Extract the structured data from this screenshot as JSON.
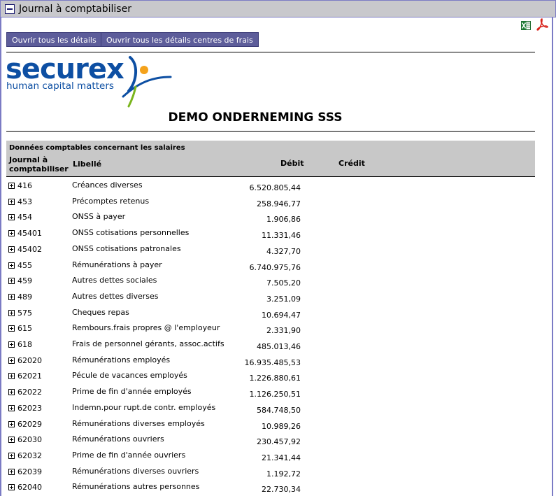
{
  "window": {
    "title": "Journal à comptabiliser"
  },
  "toolbar": {
    "open_all_label": "Ouvrir tous les détails",
    "open_all_cost_centers_label": "Ouvrir tous les détails centres de frais"
  },
  "logo": {
    "brand": "securex",
    "tagline": "human capital matters"
  },
  "company": {
    "name": "DEMO ONDERNEMING SSS"
  },
  "table": {
    "section_title": "Données comptables concernant les salaires",
    "headers": {
      "journal": "Journal à comptabiliser",
      "libelle": "Libellé",
      "debit": "Débit",
      "credit": "Crédit"
    },
    "rows": [
      {
        "account": "416",
        "label": "Créances diverses",
        "debit": "6.520.805,44"
      },
      {
        "account": "453",
        "label": "Précomptes retenus",
        "debit": "258.946,77"
      },
      {
        "account": "454",
        "label": "ONSS à payer",
        "debit": "1.906,86"
      },
      {
        "account": "45401",
        "label": "ONSS cotisations personnelles",
        "debit": "11.331,46"
      },
      {
        "account": "45402",
        "label": "ONSS cotisations patronales",
        "debit": "4.327,70"
      },
      {
        "account": "455",
        "label": "Rémunérations à payer",
        "debit": "6.740.975,76"
      },
      {
        "account": "459",
        "label": "Autres dettes sociales",
        "debit": "7.505,20"
      },
      {
        "account": "489",
        "label": "Autres dettes diverses",
        "debit": "3.251,09"
      },
      {
        "account": "575",
        "label": "Cheques repas",
        "debit": "10.694,47"
      },
      {
        "account": "615",
        "label": "Rembours.frais propres @ l'employeur",
        "debit": "2.331,90"
      },
      {
        "account": "618",
        "label": "Frais de personnel gérants, assoc.actifs",
        "debit": "485.013,46"
      },
      {
        "account": "62020",
        "label": "Rémunérations employés",
        "debit": "16.935.485,53"
      },
      {
        "account": "62021",
        "label": "Pécule de vacances employés",
        "debit": "1.226.880,61"
      },
      {
        "account": "62022",
        "label": "Prime de fin d'année employés",
        "debit": "1.126.250,51"
      },
      {
        "account": "62023",
        "label": "Indemn.pour rupt.de contr. employés",
        "debit": "584.748,50"
      },
      {
        "account": "62029",
        "label": "Rémunérations diverses employés",
        "debit": "10.989,26"
      },
      {
        "account": "62030",
        "label": "Rémunérations ouvriers",
        "debit": "230.457,92"
      },
      {
        "account": "62032",
        "label": "Prime de fin d'année ouvriers",
        "debit": "21.341,44"
      },
      {
        "account": "62039",
        "label": "Rémunérations diverses ouvriers",
        "debit": "1.192,72"
      },
      {
        "account": "62040",
        "label": "Rémunérations autres personnes",
        "debit": "22.730,34"
      }
    ]
  },
  "icons": {
    "export_excel": "excel-icon",
    "export_pdf": "pdf-icon",
    "collapse": "minus-box-icon",
    "expand": "plus-box-icon"
  },
  "colors": {
    "button_bg": "#5d5d9a",
    "header_bg": "#c8c8c8",
    "brand_blue": "#0d4fa3",
    "brand_orange": "#f4a21c",
    "brand_green": "#7ab51d"
  }
}
